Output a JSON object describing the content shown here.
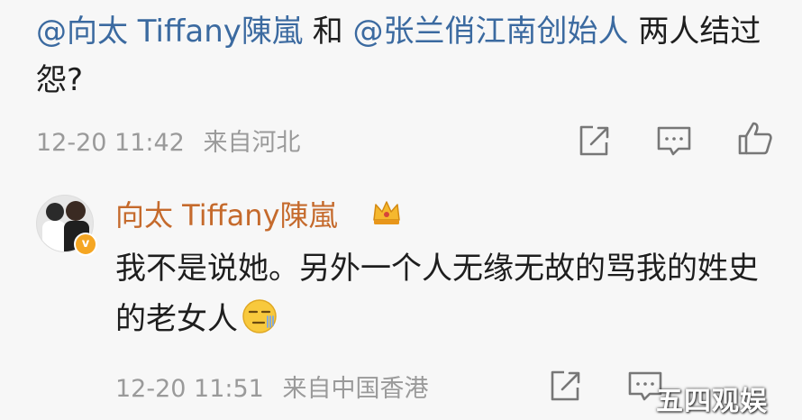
{
  "post": {
    "mention_1": "@向太 Tiffany陳嵐",
    "connector": " 和 ",
    "mention_2": "@张兰俏江南创始人",
    "text_rest": " 两人结过怨?",
    "timestamp": "12-20 11:42",
    "source": "来自河北",
    "actions": [
      "share-icon",
      "comment-icon",
      "like-icon"
    ]
  },
  "reply": {
    "author": "向太 Tiffany陳嵐",
    "verified_badge": "v",
    "text": "我不是说她。另外一个人无缘无故的骂我的姓史的老女人",
    "emoji": "speechless-face-emoji",
    "timestamp": "12-20 11:51",
    "source": "来自中国香港",
    "actions": [
      "share-icon",
      "comment-icon"
    ]
  },
  "watermark": "五四观娱",
  "colors": {
    "mention": "#3b6aa0",
    "author": "#c56a2c",
    "meta": "#9a9a9a",
    "background": "#f7f7f7"
  }
}
